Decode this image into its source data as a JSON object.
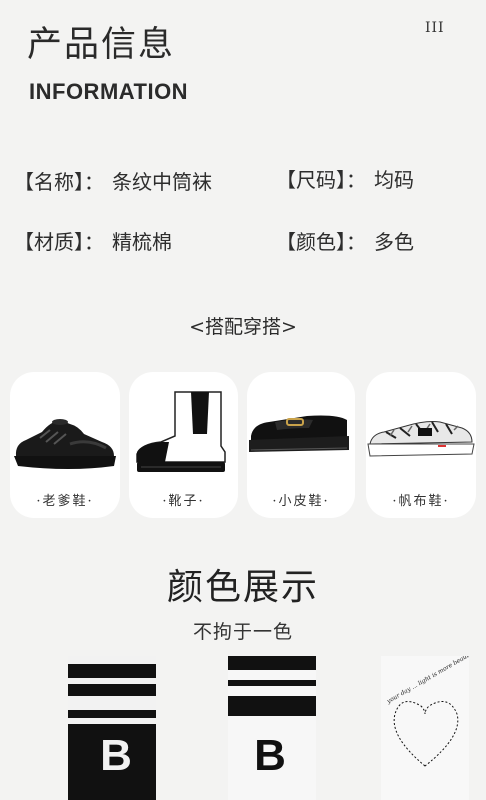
{
  "header": {
    "title_cn": "产品信息",
    "menu_mark": "III",
    "title_en": "INFORMATION"
  },
  "info": {
    "name_label": "【名称】：",
    "name_value": "条纹中筒袜",
    "size_label": "【尺码】：",
    "size_value": "均码",
    "material_label": "【材质】：",
    "material_value": "精梳棉",
    "color_label": "【颜色】：",
    "color_value": "多色"
  },
  "matching": {
    "title": "<搭配穿搭>",
    "items": [
      {
        "label": "·老爹鞋·",
        "icon": "sneaker-black-icon"
      },
      {
        "label": "·靴子·",
        "icon": "chelsea-boot-icon"
      },
      {
        "label": "·小皮鞋·",
        "icon": "loafer-icon"
      },
      {
        "label": "·帆布鞋·",
        "icon": "canvas-shoe-icon"
      }
    ]
  },
  "colors": {
    "title": "颜色展示",
    "subtitle": "不拘于一色",
    "socks": [
      {
        "name": "black-sock",
        "letter": "B"
      },
      {
        "name": "white-sock",
        "letter": "B"
      },
      {
        "name": "white-heart-sock",
        "text": "your day ... light is more beautiful than"
      }
    ]
  },
  "palette": {
    "background": "#f3f3f2",
    "card": "#ffffff",
    "text": "#2a2a2a"
  }
}
